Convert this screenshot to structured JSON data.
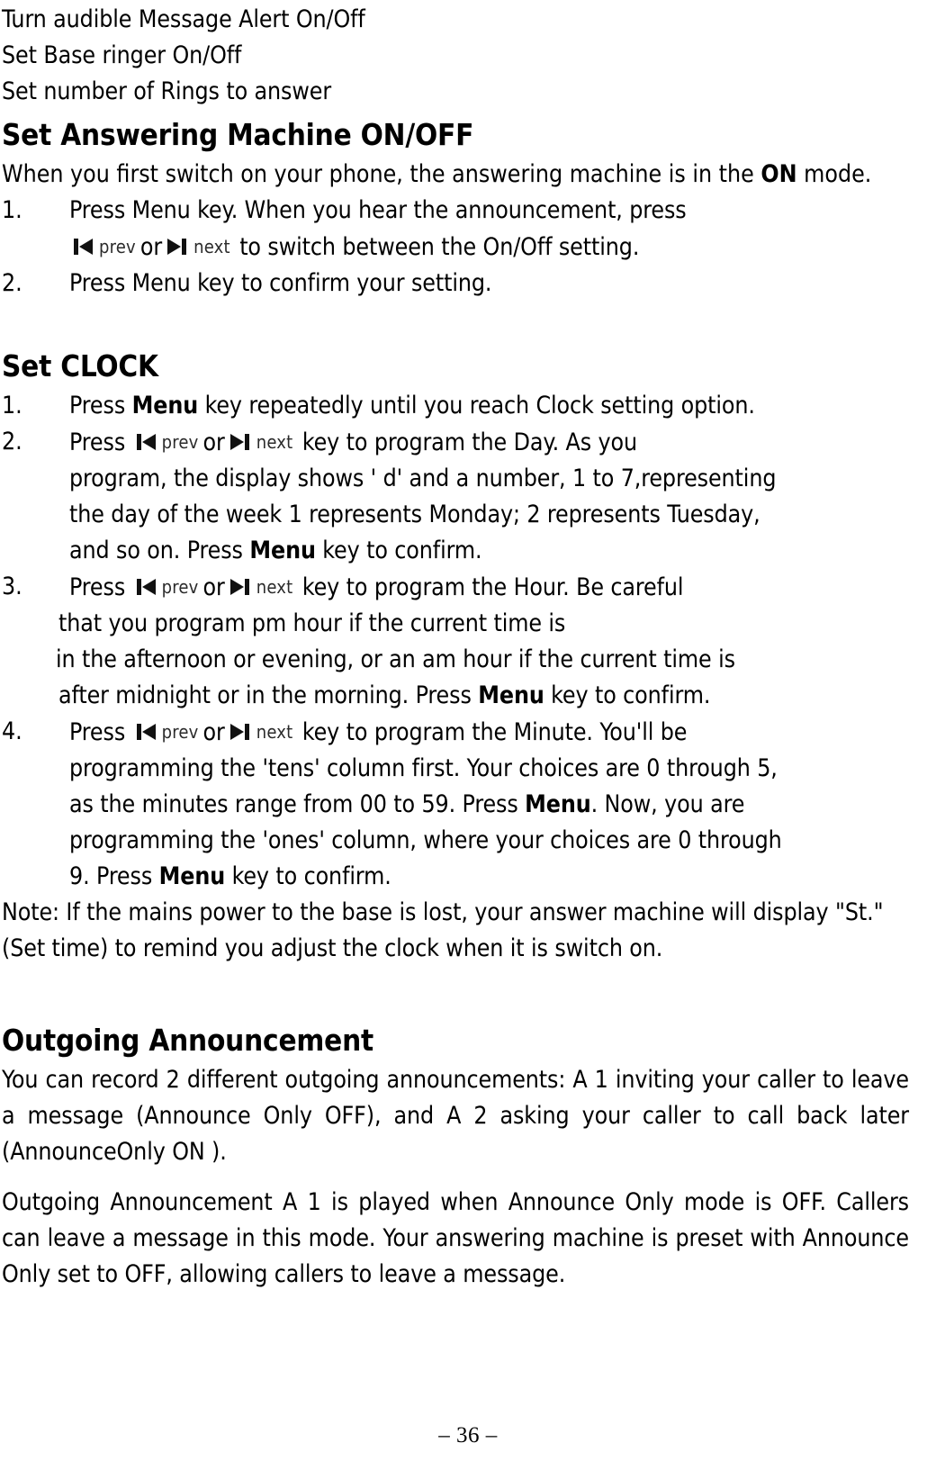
{
  "document": {
    "page_number_label": "– 36 –"
  },
  "top_lines": [
    "Turn audible Message Alert On/Off",
    "Set Base ringer On/Off",
    "Set number of Rings to answer"
  ],
  "sections": [
    {
      "id": "set-answering-machine",
      "heading": "Set Answering Machine ON/OFF",
      "intro": {
        "before": "When you first switch on your phone, the answering machine is in the ",
        "bold": "ON",
        "after": " mode."
      },
      "steps": [
        {
          "num": "1.",
          "line1_before": "Press Menu key.   When you hear the announcement, press",
          "line2_after": " to switch between the On/Off setting."
        },
        {
          "num": "2.",
          "text": "Press Menu key to confirm your setting."
        }
      ]
    },
    {
      "id": "set-clock",
      "heading": "Set CLOCK",
      "steps": [
        {
          "num": "1.",
          "t1": "Press ",
          "b1": "Menu",
          "t2": " key repeatedly until you reach Clock setting option."
        },
        {
          "num": "2.",
          "t1": "Press ",
          "t2": " key to program the Day. As you",
          "l2": "program, the display shows ' d' and a number, 1 to 7,representing",
          "l3": "the day of the week 1 represents Monday; 2 represents Tuesday,",
          "l4a": "and so on. Press ",
          "l4b": "Menu",
          "l4c": " key to confirm."
        },
        {
          "num": "3.",
          "t1": "Press ",
          "t2": " key to program the Hour. Be careful",
          "l2": "that you program pm hour if the current time is",
          "l3": "in the afternoon or evening, or an am hour if the current time is",
          "l4a": "after midnight or in the morning. Press ",
          "l4b": "Menu",
          "l4c": " key to confirm."
        },
        {
          "num": "4.",
          "t1": "Press ",
          "t2": " key to program the Minute. You'll be",
          "l2": "programming the 'tens' column first. Your choices are 0 through 5,",
          "l3a": "as the minutes range from 00 to 59. Press ",
          "l3b": "Menu",
          "l3c": ". Now, you are",
          "l4": "programming the 'ones' column, where your choices are 0 through",
          "l5a": "9. Press ",
          "l5b": "Menu",
          "l5c": " key to confirm."
        }
      ],
      "note": "Note: If the mains power to the base is lost, your answer machine will display \"St.\" (Set time) to remind you adjust the clock when it is switch on."
    },
    {
      "id": "outgoing-announcement",
      "heading": "Outgoing Announcement",
      "paragraphs": [
        "You can record 2 different outgoing announcements: A 1 inviting your caller to leave a message (Announce Only OFF), and A 2 asking your caller to call back later (AnnounceOnly ON ).",
        "Outgoing Announcement A 1 is played when Announce Only mode is OFF. Callers can leave a message in this mode. Your answering machine is preset with Announce Only set to OFF, allowing callers to leave a message."
      ]
    }
  ],
  "key_icons": {
    "prev_label": "prev",
    "next_label": "next",
    "or_label": "or",
    "prev_icon_name": "skip-previous-icon",
    "next_icon_name": "skip-next-icon"
  },
  "colors": {
    "text": "#000000",
    "key_label": "#2b2b2b",
    "background": "#ffffff"
  }
}
